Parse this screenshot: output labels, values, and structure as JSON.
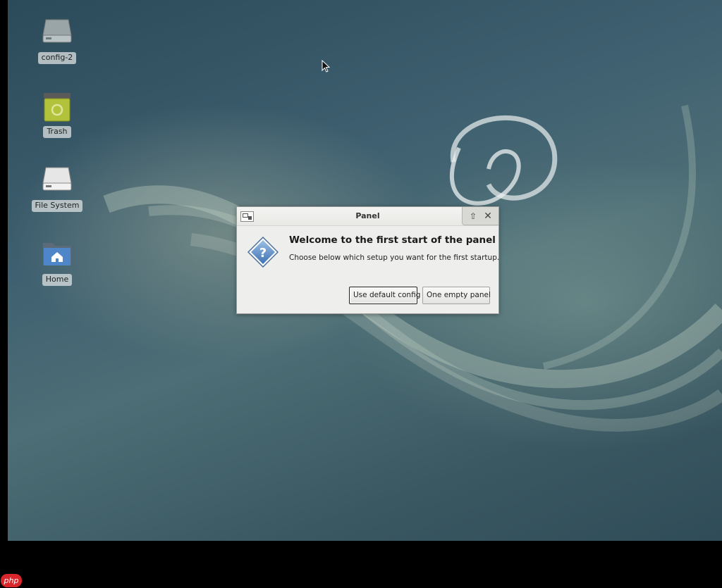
{
  "desktop": {
    "icons": [
      {
        "label": "config-2",
        "icon": "drive-icon"
      },
      {
        "label": "Trash",
        "icon": "trash-icon"
      },
      {
        "label": "File System",
        "icon": "drive-icon"
      },
      {
        "label": "Home",
        "icon": "home-folder-icon"
      }
    ]
  },
  "dialog": {
    "title": "Panel",
    "heading": "Welcome to the first start of the panel",
    "message": "Choose below which setup you want for the first startup.",
    "buttons": {
      "default_config": "Use default config",
      "empty_panel": "One empty panel"
    },
    "icon": "question-icon"
  },
  "badge": {
    "label": "php",
    "color": "#d8262b"
  }
}
